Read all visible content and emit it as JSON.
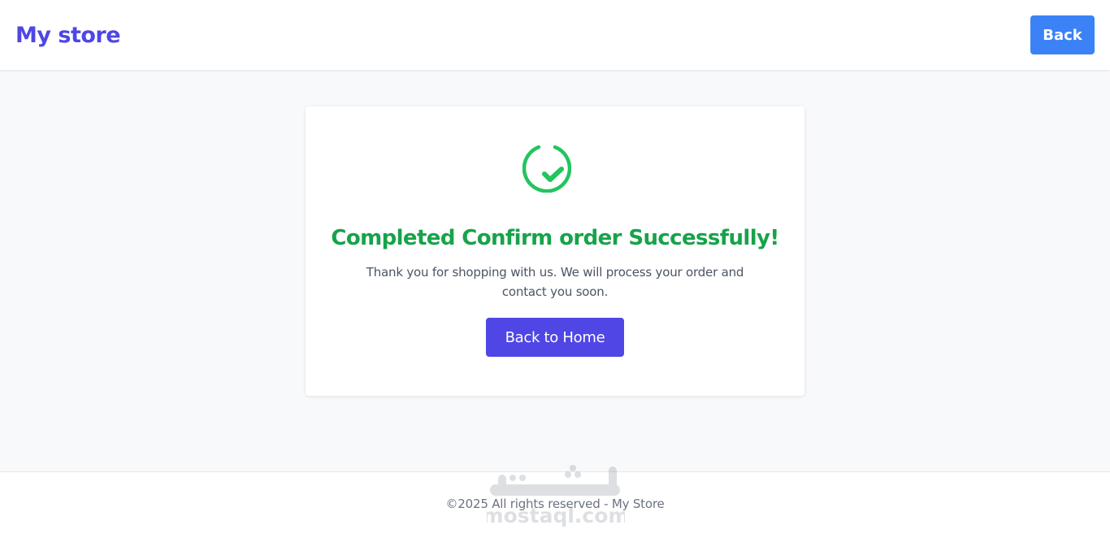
{
  "header": {
    "brand": "My store",
    "back_label": "Back"
  },
  "card": {
    "icon": "check-circle-icon",
    "title": "Completed Confirm order Successfully!",
    "message": "Thank you for shopping with us. We will process your order and contact you soon.",
    "home_button_label": "Back to Home"
  },
  "footer": {
    "copyright": "©2025 All rights reserved - My Store"
  },
  "watermark": {
    "text": "mostaql.com"
  },
  "colors": {
    "brand": "#4f46e5",
    "back_button": "#3b82f6",
    "success": "#16a34a",
    "home_button": "#4f46e5"
  }
}
